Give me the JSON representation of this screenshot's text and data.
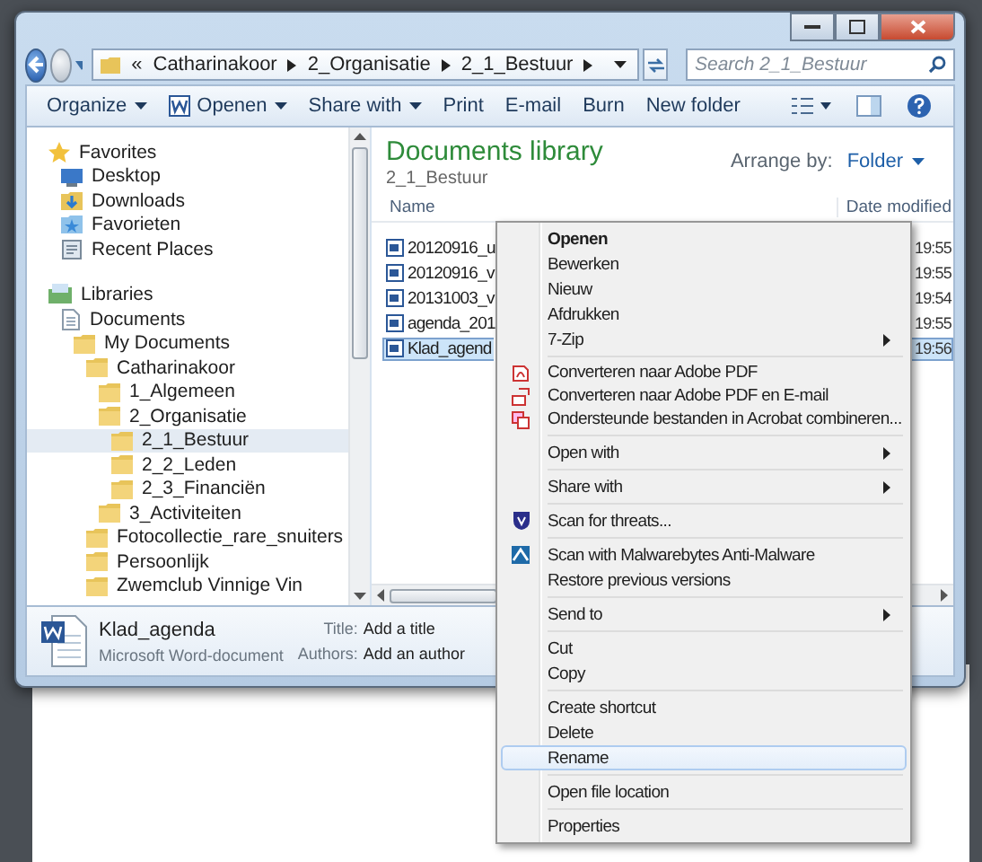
{
  "address": {
    "breadcrumbs": [
      "«",
      "Catharinakoor",
      "2_Organisatie",
      "2_1_Bestuur"
    ]
  },
  "search": {
    "placeholder": "Search 2_1_Bestuur"
  },
  "toolbar": [
    {
      "label": "Organize",
      "kind": "plain",
      "dropdown": true
    },
    {
      "label": "Openen",
      "kind": "word",
      "dropdown": true
    },
    {
      "label": "Share with",
      "kind": "plain",
      "dropdown": true
    },
    {
      "label": "Print",
      "kind": "plain",
      "dropdown": false
    },
    {
      "label": "E-mail",
      "kind": "plain",
      "dropdown": false
    },
    {
      "label": "Burn",
      "kind": "plain",
      "dropdown": false
    },
    {
      "label": "New folder",
      "kind": "plain",
      "dropdown": false
    }
  ],
  "nav": {
    "groups": [
      {
        "label": "Favorites",
        "kind": "star",
        "selected": false,
        "children": [
          {
            "label": "Desktop",
            "kind": "desktop",
            "selected": false
          },
          {
            "label": "Downloads",
            "kind": "downloads",
            "selected": false
          },
          {
            "label": "Favorieten",
            "kind": "favorites",
            "selected": false
          },
          {
            "label": "Recent Places",
            "kind": "recent",
            "selected": false
          }
        ]
      },
      {
        "label": "Libraries",
        "kind": "library",
        "selected": false,
        "children": [
          {
            "label": "Documents",
            "kind": "document",
            "selected": false,
            "children": [
              {
                "label": "My Documents",
                "kind": "folder",
                "selected": false,
                "children": [
                  {
                    "label": "Catharinakoor",
                    "kind": "folder",
                    "selected": false,
                    "children": [
                      {
                        "label": "1_Algemeen",
                        "kind": "folder",
                        "selected": false
                      },
                      {
                        "label": "2_Organisatie",
                        "kind": "folder",
                        "selected": false,
                        "children": [
                          {
                            "label": "2_1_Bestuur",
                            "kind": "folder",
                            "selected": true
                          },
                          {
                            "label": "2_2_Leden",
                            "kind": "folder",
                            "selected": false
                          },
                          {
                            "label": "2_3_Financiën",
                            "kind": "folder",
                            "selected": false
                          }
                        ]
                      },
                      {
                        "label": "3_Activiteiten",
                        "kind": "folder",
                        "selected": false
                      }
                    ]
                  },
                  {
                    "label": "Fotocollectie_rare_snuiters",
                    "kind": "folder",
                    "selected": false
                  },
                  {
                    "label": "Persoonlijk",
                    "kind": "folder",
                    "selected": false
                  },
                  {
                    "label": "Zwemclub Vinnige Vin",
                    "kind": "folder",
                    "selected": false
                  }
                ]
              }
            ]
          }
        ]
      }
    ]
  },
  "content": {
    "title": "Documents library",
    "subtitle": "2_1_Bestuur",
    "arrange_label": "Arrange by:",
    "arrange_value": "Folder",
    "columns": [
      "Name",
      "Date modified"
    ],
    "rows": [
      {
        "name": "20120916_u",
        "date": "19:55",
        "selected": false
      },
      {
        "name": "20120916_v",
        "date": "19:55",
        "selected": false
      },
      {
        "name": "20131003_v",
        "date": "19:54",
        "selected": false
      },
      {
        "name": "agenda_201",
        "date": "19:55",
        "selected": false
      },
      {
        "name": "Klad_agend",
        "date": "19:56",
        "selected": true
      }
    ]
  },
  "details": {
    "name": "Klad_agenda",
    "type": "Microsoft Word-document",
    "fields": [
      {
        "label": "Title:",
        "value": "Add a title"
      },
      {
        "label": "Authors:",
        "value": "Add an author"
      }
    ]
  },
  "context_menu": {
    "items": [
      {
        "kind": "text",
        "label": "Openen",
        "bold": true,
        "submenu": false,
        "highlighted": false
      },
      {
        "kind": "text",
        "label": "Bewerken",
        "bold": false,
        "submenu": false,
        "highlighted": false
      },
      {
        "kind": "text",
        "label": "Nieuw",
        "bold": false,
        "submenu": false,
        "highlighted": false
      },
      {
        "kind": "text",
        "label": "Afdrukken",
        "bold": false,
        "submenu": false,
        "highlighted": false
      },
      {
        "kind": "text",
        "label": "7-Zip",
        "bold": false,
        "submenu": true,
        "highlighted": false
      },
      {
        "kind": "separator"
      },
      {
        "kind": "pdf",
        "label": "Converteren naar Adobe PDF",
        "bold": false,
        "submenu": false,
        "highlighted": false
      },
      {
        "kind": "pdf-mail",
        "label": "Converteren naar Adobe PDF en E-mail",
        "bold": false,
        "submenu": false,
        "highlighted": false
      },
      {
        "kind": "pdf-combine",
        "label": "Ondersteunde bestanden in Acrobat combineren...",
        "bold": false,
        "submenu": false,
        "highlighted": false
      },
      {
        "kind": "separator"
      },
      {
        "kind": "text",
        "label": "Open with",
        "bold": false,
        "submenu": true,
        "highlighted": false
      },
      {
        "kind": "separator"
      },
      {
        "kind": "text",
        "label": "Share with",
        "bold": false,
        "submenu": true,
        "highlighted": false
      },
      {
        "kind": "separator"
      },
      {
        "kind": "shield",
        "label": "Scan for threats...",
        "bold": false,
        "submenu": false,
        "highlighted": false
      },
      {
        "kind": "separator"
      },
      {
        "kind": "malware",
        "label": "Scan with Malwarebytes Anti-Malware",
        "bold": false,
        "submenu": false,
        "highlighted": false
      },
      {
        "kind": "text",
        "label": "Restore previous versions",
        "bold": false,
        "submenu": false,
        "highlighted": false
      },
      {
        "kind": "separator"
      },
      {
        "kind": "text",
        "label": "Send to",
        "bold": false,
        "submenu": true,
        "highlighted": false
      },
      {
        "kind": "separator"
      },
      {
        "kind": "text",
        "label": "Cut",
        "bold": false,
        "submenu": false,
        "highlighted": false
      },
      {
        "kind": "text",
        "label": "Copy",
        "bold": false,
        "submenu": false,
        "highlighted": false
      },
      {
        "kind": "separator"
      },
      {
        "kind": "text",
        "label": "Create shortcut",
        "bold": false,
        "submenu": false,
        "highlighted": false
      },
      {
        "kind": "text",
        "label": "Delete",
        "bold": false,
        "submenu": false,
        "highlighted": false
      },
      {
        "kind": "text",
        "label": "Rename",
        "bold": false,
        "submenu": false,
        "highlighted": true
      },
      {
        "kind": "separator"
      },
      {
        "kind": "text",
        "label": "Open file location",
        "bold": false,
        "submenu": false,
        "highlighted": false
      },
      {
        "kind": "separator"
      },
      {
        "kind": "text",
        "label": "Properties",
        "bold": false,
        "submenu": false,
        "highlighted": false
      }
    ]
  }
}
